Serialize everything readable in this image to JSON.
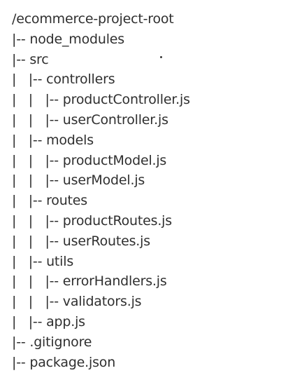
{
  "tree": {
    "lines": [
      "/ecommerce-project-root",
      "|-- node_modules",
      "|-- src",
      "|   |-- controllers",
      "|   |   |-- productController.js",
      "|   |   |-- userController.js",
      "|   |-- models",
      "|   |   |-- productModel.js",
      "|   |   |-- userModel.js",
      "|   |-- routes",
      "|   |   |-- productRoutes.js",
      "|   |   |-- userRoutes.js",
      "|   |-- utils",
      "|   |   |-- errorHandlers.js",
      "|   |   |-- validators.js",
      "|   |-- app.js",
      "|-- .gitignore",
      "|-- package.json"
    ]
  }
}
